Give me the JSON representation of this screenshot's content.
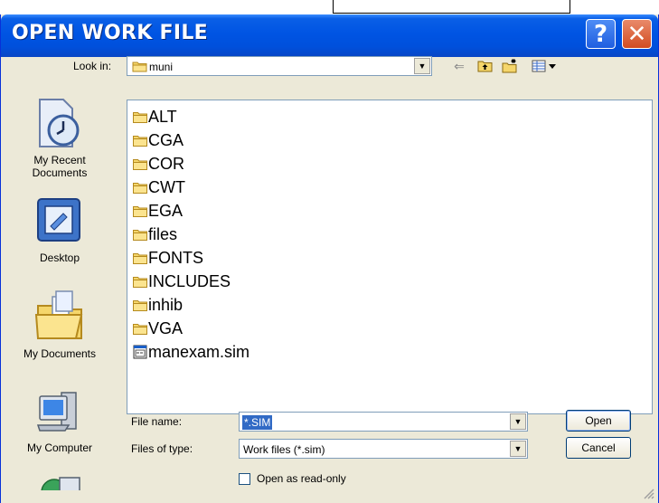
{
  "window": {
    "title": "OPEN WORK FILE"
  },
  "titlebar": {
    "help_glyph": "?",
    "close_glyph": "✕"
  },
  "lookin": {
    "label": "Look in:",
    "value": "muni"
  },
  "toolbar": {
    "back_icon": "back-arrow-icon",
    "up_icon": "up-folder-icon",
    "newfolder_icon": "new-folder-icon",
    "view_icon": "view-menu-icon"
  },
  "places": [
    {
      "label_line1": "My Recent",
      "label_line2": "Documents",
      "icon": "recent-documents-icon"
    },
    {
      "label_line1": "Desktop",
      "label_line2": "",
      "icon": "desktop-icon"
    },
    {
      "label_line1": "My Documents",
      "label_line2": "",
      "icon": "my-documents-icon"
    },
    {
      "label_line1": "My Computer",
      "label_line2": "",
      "icon": "my-computer-icon"
    }
  ],
  "files": [
    {
      "name": "ALT",
      "type": "folder"
    },
    {
      "name": "CGA",
      "type": "folder"
    },
    {
      "name": "COR",
      "type": "folder"
    },
    {
      "name": "CWT",
      "type": "folder"
    },
    {
      "name": "EGA",
      "type": "folder"
    },
    {
      "name": "files",
      "type": "folder"
    },
    {
      "name": "FONTS",
      "type": "folder"
    },
    {
      "name": "INCLUDES",
      "type": "folder"
    },
    {
      "name": "inhib",
      "type": "folder"
    },
    {
      "name": "VGA",
      "type": "folder"
    },
    {
      "name": "manexam.sim",
      "type": "file"
    }
  ],
  "filename": {
    "label": "File name:",
    "value": "*.SIM"
  },
  "filetype": {
    "label": "Files of type:",
    "value": "Work files (*.sim)"
  },
  "buttons": {
    "open": "Open",
    "cancel": "Cancel"
  },
  "readonly": {
    "label": "Open as read-only",
    "checked": false
  },
  "colors": {
    "titlebar": "#0054e3",
    "dialog_bg": "#ece9d8",
    "selection": "#316ac5",
    "close_button": "#d24c21"
  }
}
